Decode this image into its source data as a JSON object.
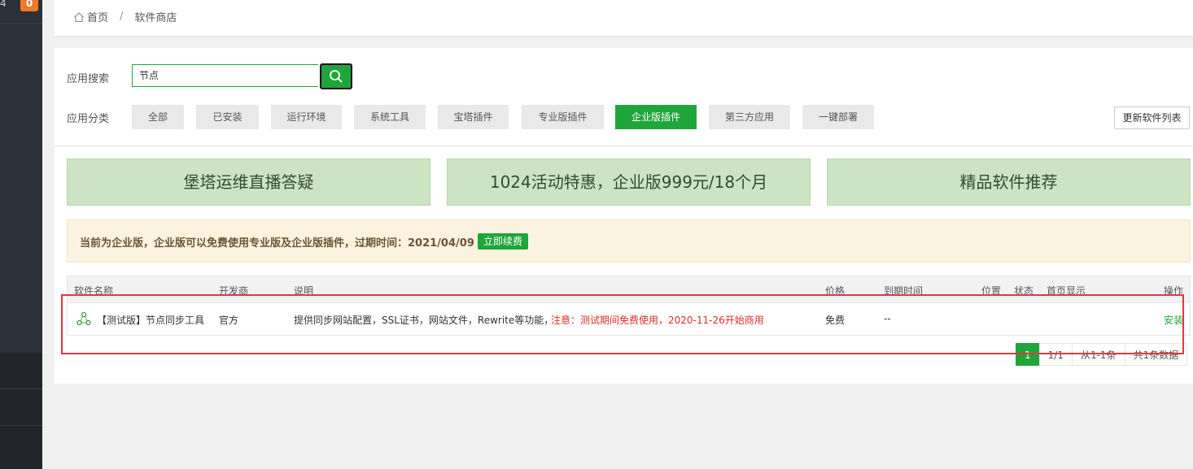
{
  "sidebar": {
    "count_fragment": "4",
    "badge": "0"
  },
  "breadcrumb": {
    "home": "首页",
    "separator": "/",
    "current": "软件商店"
  },
  "search": {
    "label": "应用搜索",
    "value": "节点"
  },
  "categories": {
    "label": "应用分类",
    "items": [
      "全部",
      "已安装",
      "运行环境",
      "系统工具",
      "宝塔插件",
      "专业版插件",
      "企业版插件",
      "第三方应用",
      "一键部署"
    ],
    "active": "企业版插件"
  },
  "refresh_button": "更新软件列表",
  "promos": [
    "堡塔运维直播答疑",
    "1024活动特惠，企业版999元/18个月",
    "精品软件推荐"
  ],
  "notice": {
    "text": "当前为企业版，企业版可以免费使用专业版及企业版插件，过期时间：2021/04/09",
    "button": "立即续费"
  },
  "table": {
    "headers": [
      "软件名称",
      "开发商",
      "说明",
      "价格",
      "到期时间",
      "位置",
      "状态",
      "首页显示",
      "操作"
    ],
    "rows": [
      {
        "name": "【测试版】节点同步工具",
        "developer": "官方",
        "description": "提供同步网站配置，SSL证书，网站文件，Rewrite等功能，",
        "notice": "注意：测试期间免费使用，2020-11-26开始商用",
        "price": "免费",
        "expire": "--",
        "action": "安装"
      }
    ]
  },
  "pagination": {
    "current": "1",
    "pages": "1/1",
    "range": "从1-1条",
    "total": "共1条数据"
  },
  "colors": {
    "brand_green": "#20a53a",
    "highlight_red": "#e0393e",
    "promo_bg": "#cde4c4",
    "notice_bg": "#fbf3e0"
  }
}
